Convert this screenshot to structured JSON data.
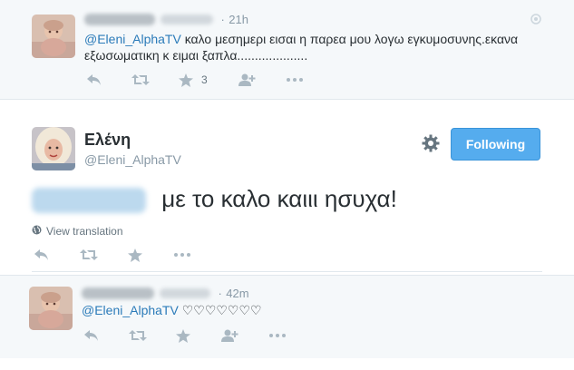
{
  "reply_top": {
    "time": "21h",
    "text_mention": "@Eleni_AlphaTV",
    "text_line1": " καλο μεσημερι  εισαι η παρεα μου λογω εγκυμοσυνης.εκανα",
    "text_line2": "εξωσωματικη κ ειμαι ξαπλα....................",
    "favorite_count": "3",
    "dot": "·"
  },
  "main_tweet": {
    "display_name": "Ελένη",
    "handle": "@Eleni_AlphaTV",
    "follow_label": "Following",
    "text": " με το καλο καιιι ησυχα!",
    "view_translation": "View translation"
  },
  "reply_bottom": {
    "time": "42m",
    "text_mention": "@Eleni_AlphaTV",
    "text_body": " ♡♡♡♡♡♡♡",
    "dot": "·"
  },
  "colors": {
    "accent": "#55acee",
    "link": "#2b7bb9",
    "muted": "#8899a6",
    "icon": "#aab8c2",
    "panel": "#f5f8fa"
  },
  "icons": [
    "reply-icon",
    "retweet-icon",
    "favorite-icon",
    "follow-user-icon",
    "more-icon",
    "gear-icon",
    "globe-icon",
    "geo-icon"
  ]
}
